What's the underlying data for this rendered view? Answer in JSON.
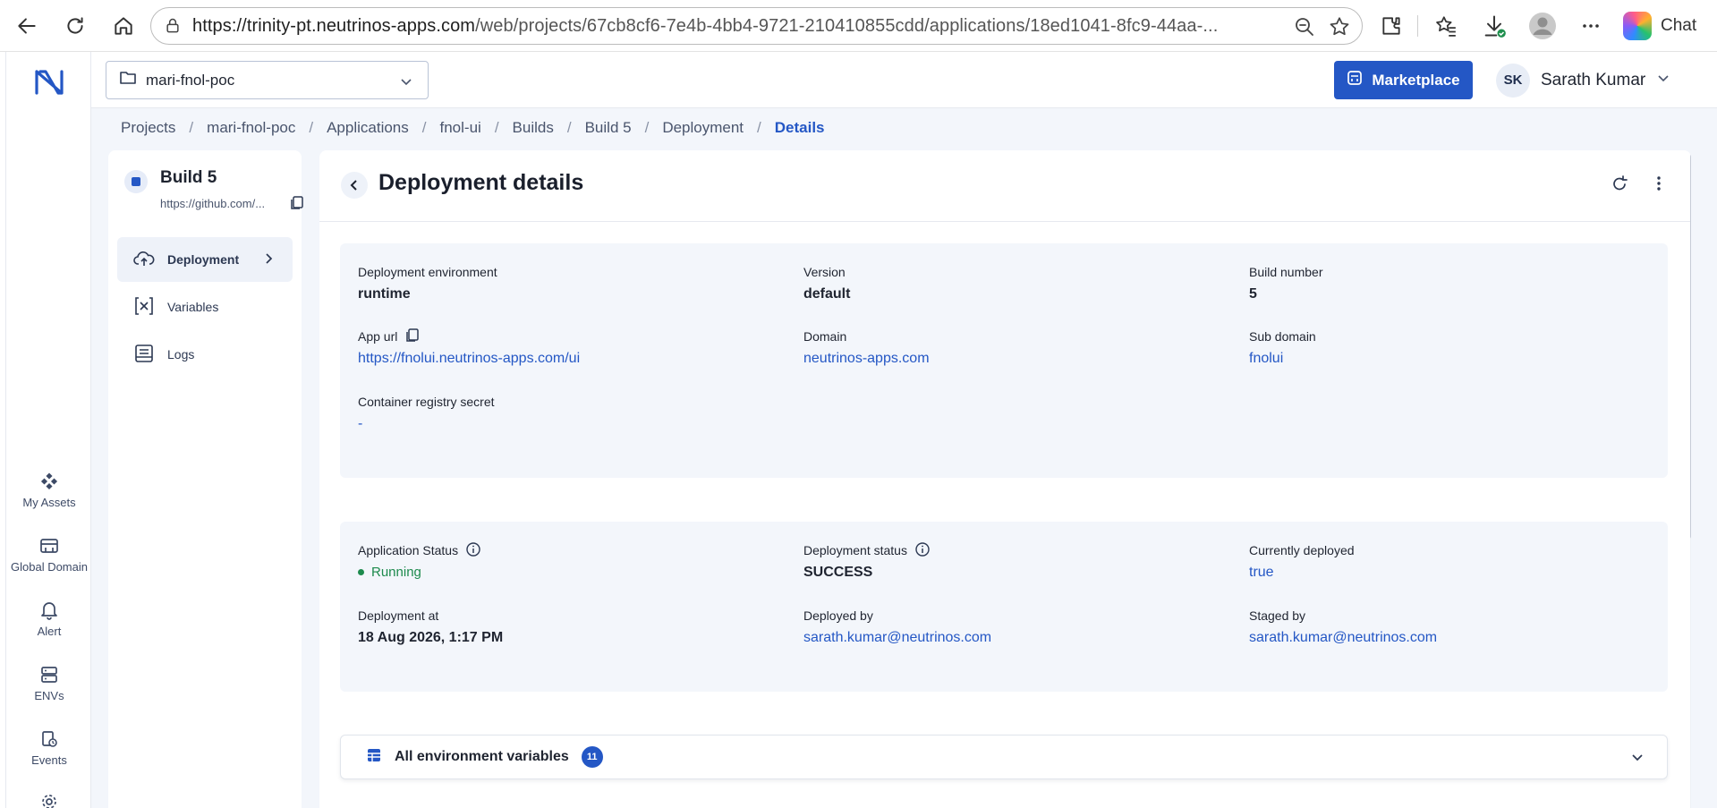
{
  "browser": {
    "url_host": "https://trinity-pt.neutrinos-apps.com",
    "url_path": "/web/projects/67cb8cf6-7e4b-4bb4-9721-210410855cdd/applications/18ed1041-8fc9-44aa-...",
    "chat_label": "Chat"
  },
  "header": {
    "project_name": "mari-fnol-poc",
    "marketplace_label": "Marketplace",
    "user_initials": "SK",
    "user_name": "Sarath Kumar"
  },
  "rail": {
    "items": [
      {
        "label": "My Assets",
        "icon": "assets-icon"
      },
      {
        "label": "Global Domain",
        "icon": "domain-icon"
      },
      {
        "label": "Alert",
        "icon": "bell-icon"
      },
      {
        "label": "ENVs",
        "icon": "server-icon"
      },
      {
        "label": "Events",
        "icon": "events-icon"
      }
    ]
  },
  "breadcrumb": [
    "Projects",
    "mari-fnol-poc",
    "Applications",
    "fnol-ui",
    "Builds",
    "Build 5",
    "Deployment",
    "Details"
  ],
  "build": {
    "title": "Build 5",
    "url": "https://github.com/..."
  },
  "subnav": [
    {
      "label": "Deployment",
      "active": true
    },
    {
      "label": "Variables",
      "active": false
    },
    {
      "label": "Logs",
      "active": false
    }
  ],
  "details": {
    "title": "Deployment details",
    "card1": {
      "deployment_environment_label": "Deployment environment",
      "deployment_environment": "runtime",
      "version_label": "Version",
      "version": "default",
      "build_number_label": "Build number",
      "build_number": "5",
      "app_url_label": "App url",
      "app_url": "https://fnolui.neutrinos-apps.com/ui",
      "domain_label": "Domain",
      "domain": "neutrinos-apps.com",
      "sub_domain_label": "Sub domain",
      "sub_domain": "fnolui",
      "registry_secret_label": "Container registry secret",
      "registry_secret": "-"
    },
    "card2": {
      "app_status_label": "Application Status",
      "app_status": "Running",
      "deployment_status_label": "Deployment status",
      "deployment_status": "SUCCESS",
      "currently_deployed_label": "Currently deployed",
      "currently_deployed": "true",
      "deployment_at_label": "Deployment at",
      "deployment_at": "18 Aug 2026, 1:17 PM",
      "deployed_by_label": "Deployed by",
      "deployed_by": "sarath.kumar@neutrinos.com",
      "staged_by_label": "Staged by",
      "staged_by": "sarath.kumar@neutrinos.com"
    },
    "env_vars_label": "All environment variables",
    "env_vars_count": "11"
  },
  "colors": {
    "accent": "#2457c5",
    "running": "#1d8a4d",
    "card_bg": "#f3f6fb"
  }
}
